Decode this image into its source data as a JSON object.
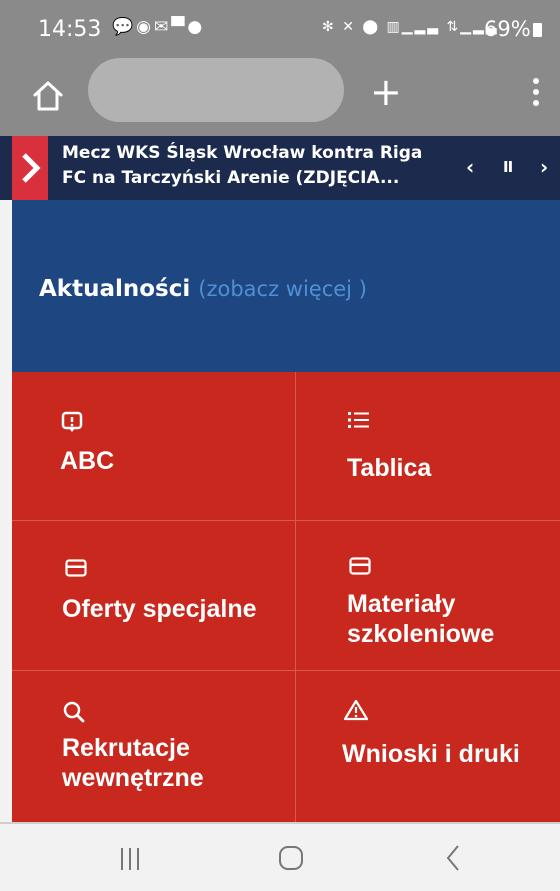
{
  "status_bar": {
    "time": "14:53",
    "battery": "69%",
    "left_icons": [
      "chat-bubble-icon",
      "messenger-icon",
      "mail-icon",
      "shopping-bag-icon",
      "viber-icon"
    ],
    "right_icons": [
      "bluetooth-icon",
      "mute-icon",
      "location-icon",
      "volte-icon",
      "signal-icon",
      "lte-icon",
      "signal-icon",
      "battery-icon"
    ]
  },
  "browser": {
    "plus_label": "+",
    "icons": [
      "home-icon",
      "more-vertical-icon"
    ]
  },
  "ticker": {
    "headline": "Mecz WKS Śląsk Wrocław kontra Riga FC na Tarczyński Arenie (ZDJĘCIA...",
    "prev_label": "‹",
    "pause_label": "II",
    "next_label": "›"
  },
  "news": {
    "title": "Aktualności",
    "more_link": "(zobacz więcej )"
  },
  "tiles": [
    {
      "label": "ABC",
      "icon": "alert-message-icon"
    },
    {
      "label": "Tablica",
      "icon": "list-icon"
    },
    {
      "label": "Oferty specjalne",
      "icon": "credit-card-icon"
    },
    {
      "label": "Materiały szkoleniowe",
      "icon": "credit-card-icon"
    },
    {
      "label": "Rekrutacje wewnętrzne",
      "icon": "search-icon"
    },
    {
      "label": "Wnioski i druki",
      "icon": "warning-triangle-icon"
    }
  ],
  "colors": {
    "status_bar": "#8a8a8a",
    "ticker_bg": "#1c2a4d",
    "ticker_accent": "#d8303c",
    "news_bg": "#1e4781",
    "news_link": "#4f8fd6",
    "tiles_bg": "#c8281e",
    "nav_bg": "#f2f2f2"
  }
}
